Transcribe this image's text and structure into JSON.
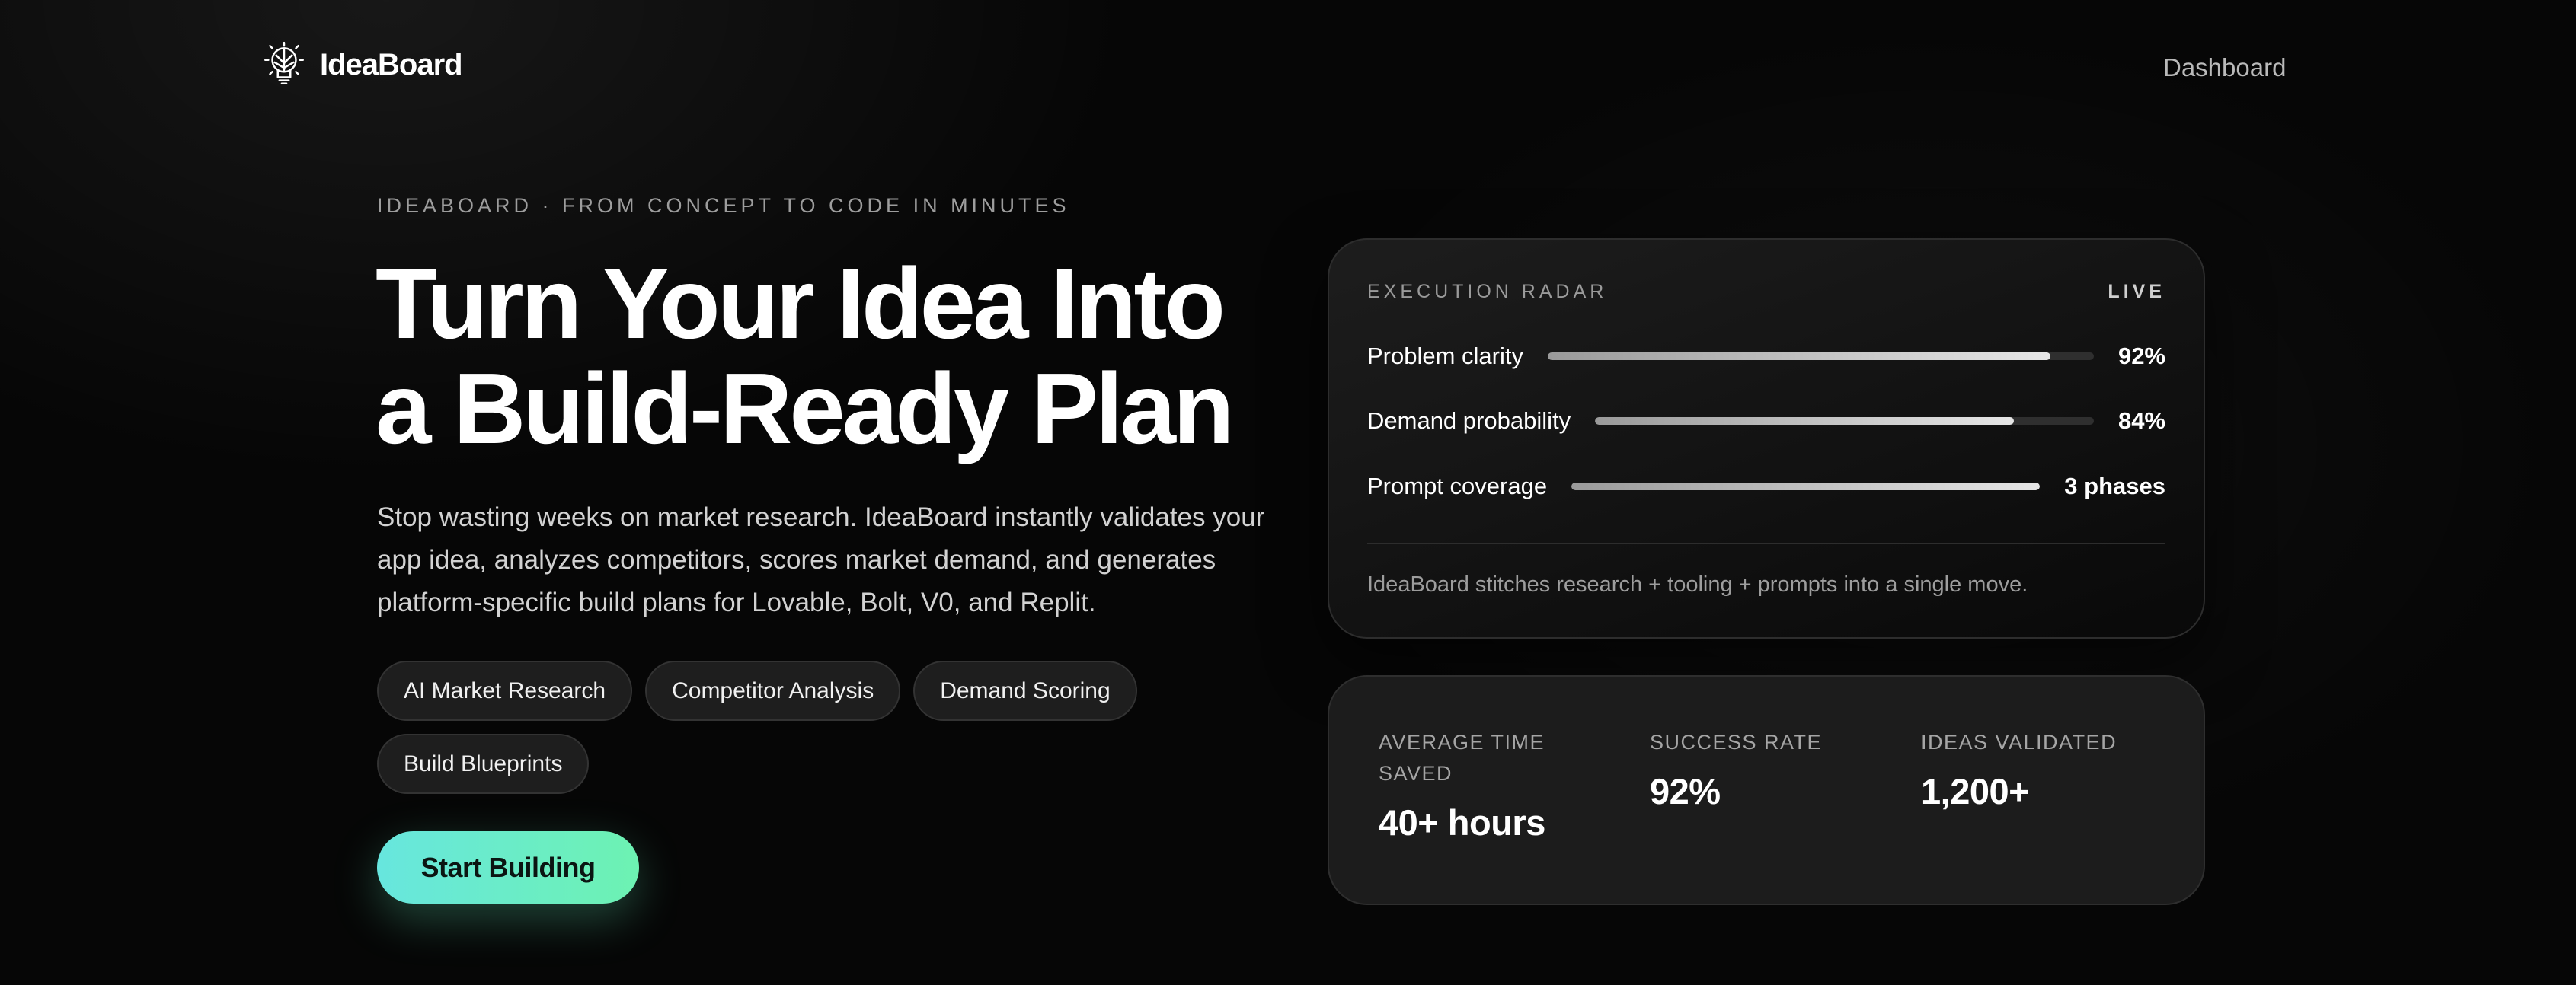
{
  "header": {
    "brand_name": "IdeaBoard",
    "brand_icon": "lightbulb-icon",
    "nav_link": "Dashboard"
  },
  "hero": {
    "eyebrow": "IDEABOARD · FROM CONCEPT TO CODE IN MINUTES",
    "title_line1": "Turn Your Idea Into",
    "title_line2": "a Build-Ready Plan",
    "description": "Stop wasting weeks on market research. IdeaBoard instantly validates your app idea, analyzes competitors, scores market demand, and generates platform-specific build plans for Lovable, Bolt, V0, and Replit.",
    "tags": [
      "AI Market Research",
      "Competitor Analysis",
      "Demand Scoring",
      "Build Blueprints"
    ],
    "cta_label": "Start Building",
    "cta_colors": [
      "#67e6de",
      "#6df2b2"
    ]
  },
  "radar": {
    "title": "EXECUTION RADAR",
    "status": "LIVE",
    "metrics": [
      {
        "label": "Problem clarity",
        "value": "92%",
        "fill": 0.92
      },
      {
        "label": "Demand probability",
        "value": "84%",
        "fill": 0.84
      },
      {
        "label": "Prompt coverage",
        "value": "3 phases",
        "fill": 1.0
      }
    ],
    "note": "IdeaBoard stitches research + tooling + prompts into a single move."
  },
  "stats": [
    {
      "label": "AVERAGE TIME SAVED",
      "value": "40+ hours"
    },
    {
      "label": "SUCCESS RATE",
      "value": "92%"
    },
    {
      "label": "IDEAS VALIDATED",
      "value": "1,200+"
    }
  ]
}
